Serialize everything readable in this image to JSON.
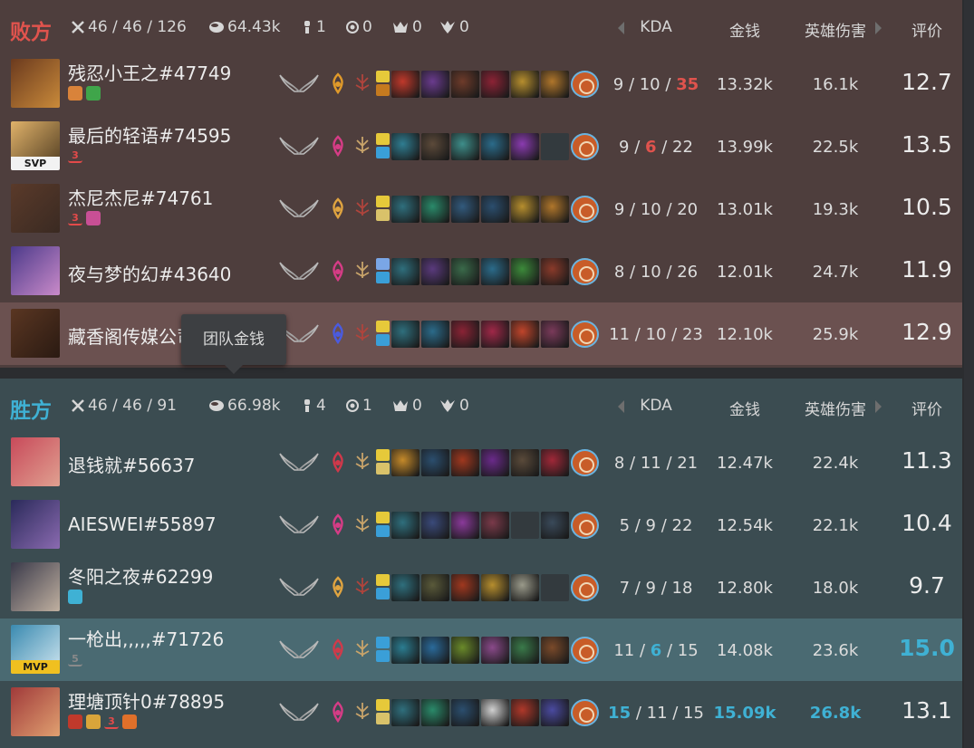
{
  "tooltip": "团队金钱",
  "columns": {
    "kda": "KDA",
    "gold": "金钱",
    "damage": "英雄伤害",
    "score": "评价"
  },
  "teams": [
    {
      "id": "lose",
      "name": "败方",
      "kda": "46 / 46 / 126",
      "gold": "64.43k",
      "towers": "1",
      "inhibitors": "0",
      "barons": "0",
      "dragons": "0",
      "players": [
        {
          "name": "残忍小王之#47749",
          "kills": "9",
          "deaths": "10",
          "assists": "35",
          "gold": "13.32k",
          "damage": "16.1k",
          "score": "12.7",
          "avatar_colors": [
            "#6b3a1e",
            "#c98a3a"
          ],
          "tags": [
            {
              "icon": "fist-badge",
              "text": "",
              "color": "#d9833a"
            },
            {
              "icon": "shield-badge",
              "text": "",
              "color": "#3fa54a"
            }
          ],
          "rune": "domination-keystone",
          "rune_color": "#e09a2a",
          "sub_rune": "precision",
          "sub_color": "#b0443c",
          "spells": [
            "#e6c93a",
            "#c57a1f"
          ],
          "items": [
            "#c0392b",
            "#6a3b8e",
            "#6e3b2a",
            "#8c2335",
            "#b68e2e",
            "#b0762b"
          ]
        },
        {
          "name": "最后的轻语#74595",
          "kills": "9",
          "deaths": "6",
          "assists": "22",
          "gold": "13.99k",
          "damage": "22.5k",
          "score": "13.5",
          "avatar_colors": [
            "#e0b26a",
            "#4d3a20"
          ],
          "avatar_badge": "SVP",
          "tags": [
            {
              "icon": "rank-badge",
              "text": "3",
              "color": "#e34a4a"
            }
          ],
          "rune": "sorcery-keystone",
          "rune_color": "#d63c86",
          "sub_rune": "inspiration",
          "sub_color": "#c9a46a",
          "spells": [
            "#e6c93a",
            "#3a9fd8"
          ],
          "items": [
            "#2f7d91",
            "#5c4a3a",
            "#3e8e8a",
            "#2b6b8a",
            "#8a3bb0",
            "#empty"
          ]
        },
        {
          "name": "杰尼杰尼#74761",
          "kills": "9",
          "deaths": "10",
          "assists": "20",
          "gold": "13.01k",
          "damage": "19.3k",
          "score": "10.5",
          "avatar_colors": [
            "#5a3a2a",
            "#3a2a22"
          ],
          "tags": [
            {
              "icon": "rank-badge",
              "text": "3",
              "color": "#e34a4a"
            },
            {
              "icon": "skull-badge",
              "text": "",
              "color": "#c84f95"
            }
          ],
          "rune": "precision-keystone",
          "rune_color": "#e0a440",
          "sub_rune": "precision",
          "sub_color": "#b0443c",
          "spells": [
            "#e6c93a",
            "#d9c26a"
          ],
          "items": [
            "#2f6f7d",
            "#2a8a6a",
            "#325a7d",
            "#2b4e6e",
            "#b68e2e",
            "#b0762b"
          ]
        },
        {
          "name": "夜与梦的幻#43640",
          "kills": "8",
          "deaths": "10",
          "assists": "26",
          "gold": "12.01k",
          "damage": "24.7k",
          "score": "11.9",
          "avatar_colors": [
            "#4c3a8a",
            "#c98ac9"
          ],
          "tags": [],
          "rune": "sorcery-keystone",
          "rune_color": "#d63c86",
          "sub_rune": "inspiration",
          "sub_color": "#c9a46a",
          "spells": [
            "#7aa6e6",
            "#3a9fd8"
          ],
          "items": [
            "#2f6f7d",
            "#5a3a7d",
            "#3a6a4a",
            "#2b6b8a",
            "#3c8a3a",
            "#8a3a2a"
          ]
        },
        {
          "name": "藏香阁传媒公司#83367",
          "kills": "11",
          "deaths": "10",
          "assists": "23",
          "gold": "12.10k",
          "damage": "25.9k",
          "score": "12.9",
          "avatar_colors": [
            "#5a3622",
            "#2a1a12"
          ],
          "tags": [],
          "highlight": true,
          "rune": "dark-harvest-keystone",
          "rune_color": "#4a5be0",
          "sub_rune": "precision",
          "sub_color": "#b0443c",
          "spells": [
            "#e6c93a",
            "#3a9fd8"
          ],
          "items": [
            "#2f6f7d",
            "#2b6b8a",
            "#8a2335",
            "#a02848",
            "#c0452b",
            "#7a3a5a"
          ]
        }
      ]
    },
    {
      "id": "win",
      "name": "胜方",
      "kda": "46 / 46 / 91",
      "gold": "66.98k",
      "towers": "4",
      "inhibitors": "1",
      "barons": "0",
      "dragons": "0",
      "players": [
        {
          "name": "退钱就#56637",
          "kills": "8",
          "deaths": "11",
          "assists": "21",
          "gold": "12.47k",
          "damage": "22.4k",
          "score": "11.3",
          "avatar_colors": [
            "#c84a5a",
            "#e0a090"
          ],
          "tags": [],
          "rune": "conqueror-keystone",
          "rune_color": "#d0384a",
          "sub_rune": "inspiration",
          "sub_color": "#c9a46a",
          "spells": [
            "#e6c93a",
            "#d9c26a"
          ],
          "items": [
            "#c58a2a",
            "#2b4e6e",
            "#a0381f",
            "#6a2a8a",
            "#5a4a3a",
            "#a02838"
          ]
        },
        {
          "name": "AIESWEI#55897",
          "kills": "5",
          "deaths": "9",
          "assists": "22",
          "gold": "12.54k",
          "damage": "22.1k",
          "score": "10.4",
          "avatar_colors": [
            "#2a2a5a",
            "#8a6ab0"
          ],
          "tags": [],
          "rune": "sorcery-keystone",
          "rune_color": "#d63c86",
          "sub_rune": "inspiration",
          "sub_color": "#c9a46a",
          "spells": [
            "#e6c93a",
            "#3a9fd8"
          ],
          "items": [
            "#2f6f7d",
            "#3a4a7a",
            "#8a3a9a",
            "#7a3a4a",
            "#empty",
            "#3a4a5a"
          ]
        },
        {
          "name": "冬阳之夜#62299",
          "kills": "7",
          "deaths": "9",
          "assists": "18",
          "gold": "12.80k",
          "damage": "18.0k",
          "score": "9.7",
          "avatar_colors": [
            "#3a3a4a",
            "#c0b0a0"
          ],
          "tags": [
            {
              "icon": "castle-badge",
              "text": "",
              "color": "#3fb1d4"
            }
          ],
          "rune": "precision-keystone",
          "rune_color": "#e0a440",
          "sub_rune": "precision",
          "sub_color": "#b0443c",
          "spells": [
            "#e6c93a",
            "#3a9fd8"
          ],
          "items": [
            "#2f6f7d",
            "#5a5a3a",
            "#a0381f",
            "#b68e2e",
            "#9a9a8a",
            "#empty"
          ]
        },
        {
          "name": "一枪出,,,,,#71726",
          "kills": "11",
          "deaths": "6",
          "assists": "15",
          "gold": "14.08k",
          "damage": "23.6k",
          "score": "15.0",
          "avatar_colors": [
            "#3a8ab0",
            "#d0e6f0"
          ],
          "avatar_badge": "MVP",
          "tags": [
            {
              "icon": "rank-badge",
              "text": "5",
              "color": "#8a8a8a"
            }
          ],
          "highlight": true,
          "rune": "electrocute-keystone",
          "rune_color": "#d03a4a",
          "sub_rune": "inspiration",
          "sub_color": "#c9a46a",
          "spells": [
            "#3a9fd8",
            "#3a9fd8"
          ],
          "items": [
            "#2b7d91",
            "#2a6a9a",
            "#6a8a2a",
            "#8a4a8a",
            "#3a7a4a",
            "#7a4a2a"
          ]
        },
        {
          "name": "理塘顶针0#78895",
          "kills": "15",
          "deaths": "11",
          "assists": "15",
          "gold": "15.09k",
          "damage": "26.8k",
          "score": "13.1",
          "avatar_colors": [
            "#a03a3a",
            "#e0a070"
          ],
          "tags": [
            {
              "icon": "crossed-swords-badge",
              "text": "",
              "color": "#c0392b"
            },
            {
              "icon": "coin-badge",
              "text": "",
              "color": "#d9a53a"
            },
            {
              "icon": "rank-badge",
              "text": "3",
              "color": "#e34a4a"
            },
            {
              "icon": "fire-badge",
              "text": "",
              "color": "#e0702a"
            }
          ],
          "rune": "sorcery-keystone",
          "rune_color": "#d63c86",
          "sub_rune": "inspiration",
          "sub_color": "#c9a46a",
          "spells": [
            "#e6c93a",
            "#d9c26a"
          ],
          "items": [
            "#2f6f7d",
            "#2a8a6a",
            "#2b4e6e",
            "#d0d0d0",
            "#b0382a",
            "#4a4aa0"
          ]
        }
      ]
    }
  ]
}
